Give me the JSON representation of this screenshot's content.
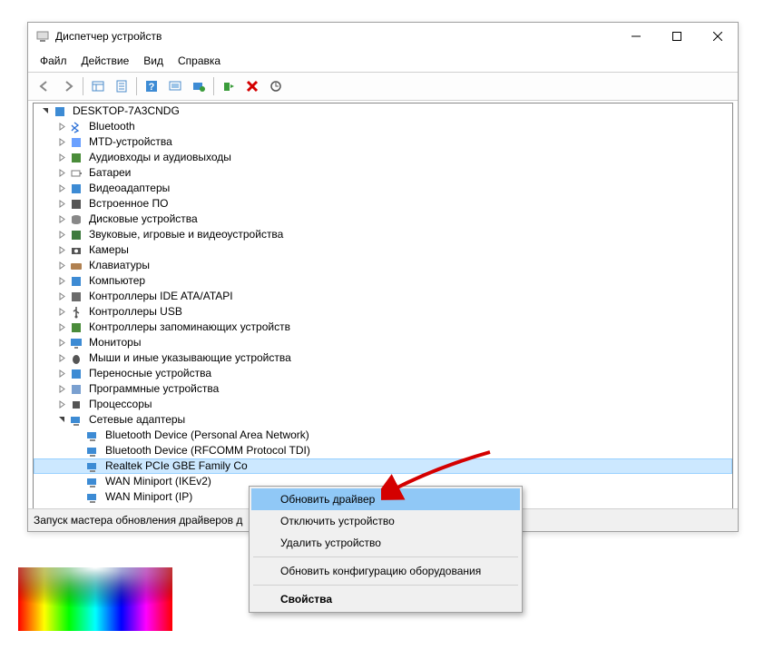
{
  "window": {
    "title": "Диспетчер устройств"
  },
  "menu": {
    "file": "Файл",
    "action": "Действие",
    "view": "Вид",
    "help": "Справка"
  },
  "root": "DESKTOP-7A3CNDG",
  "categories": [
    "Bluetooth",
    "MTD-устройства",
    "Аудиовходы и аудиовыходы",
    "Батареи",
    "Видеоадаптеры",
    "Встроенное ПО",
    "Дисковые устройства",
    "Звуковые, игровые и видеоустройства",
    "Камеры",
    "Клавиатуры",
    "Компьютер",
    "Контроллеры IDE ATA/ATAPI",
    "Контроллеры USB",
    "Контроллеры запоминающих устройств",
    "Мониторы",
    "Мыши и иные указывающие устройства",
    "Переносные устройства",
    "Программные устройства",
    "Процессоры"
  ],
  "netadapters": {
    "label": "Сетевые адаптеры",
    "items": [
      "Bluetooth Device (Personal Area Network)",
      "Bluetooth Device (RFCOMM Protocol TDI)",
      "Realtek PCIe GBE Family Co",
      "WAN Miniport (IKEv2)",
      "WAN Miniport (IP)"
    ],
    "selectedIndex": 2
  },
  "context": {
    "items": [
      "Обновить драйвер",
      "Отключить устройство",
      "Удалить устройство",
      "Обновить конфигурацию оборудования",
      "Свойства"
    ],
    "highlight": 0
  },
  "status": "Запуск мастера обновления драйверов д",
  "iconColors": {
    "bluetooth": "#2a6fd6",
    "mtd": "#6aa0ff",
    "audio": "#4a8c3a",
    "battery": "#7a7a7a",
    "display": "#3d8bd4",
    "firmware": "#555",
    "disk": "#888",
    "sound": "#3d7a3d",
    "camera": "#555",
    "keyboard": "#b08050",
    "computer": "#3d8bd4",
    "ide": "#6b6b6b",
    "usb": "#555",
    "storage": "#4a8c3a",
    "monitor": "#3d8bd4",
    "mouse": "#555",
    "portable": "#3d8bd4",
    "software": "#7aa0d0",
    "cpu": "#555",
    "net": "#3d8bd4"
  }
}
